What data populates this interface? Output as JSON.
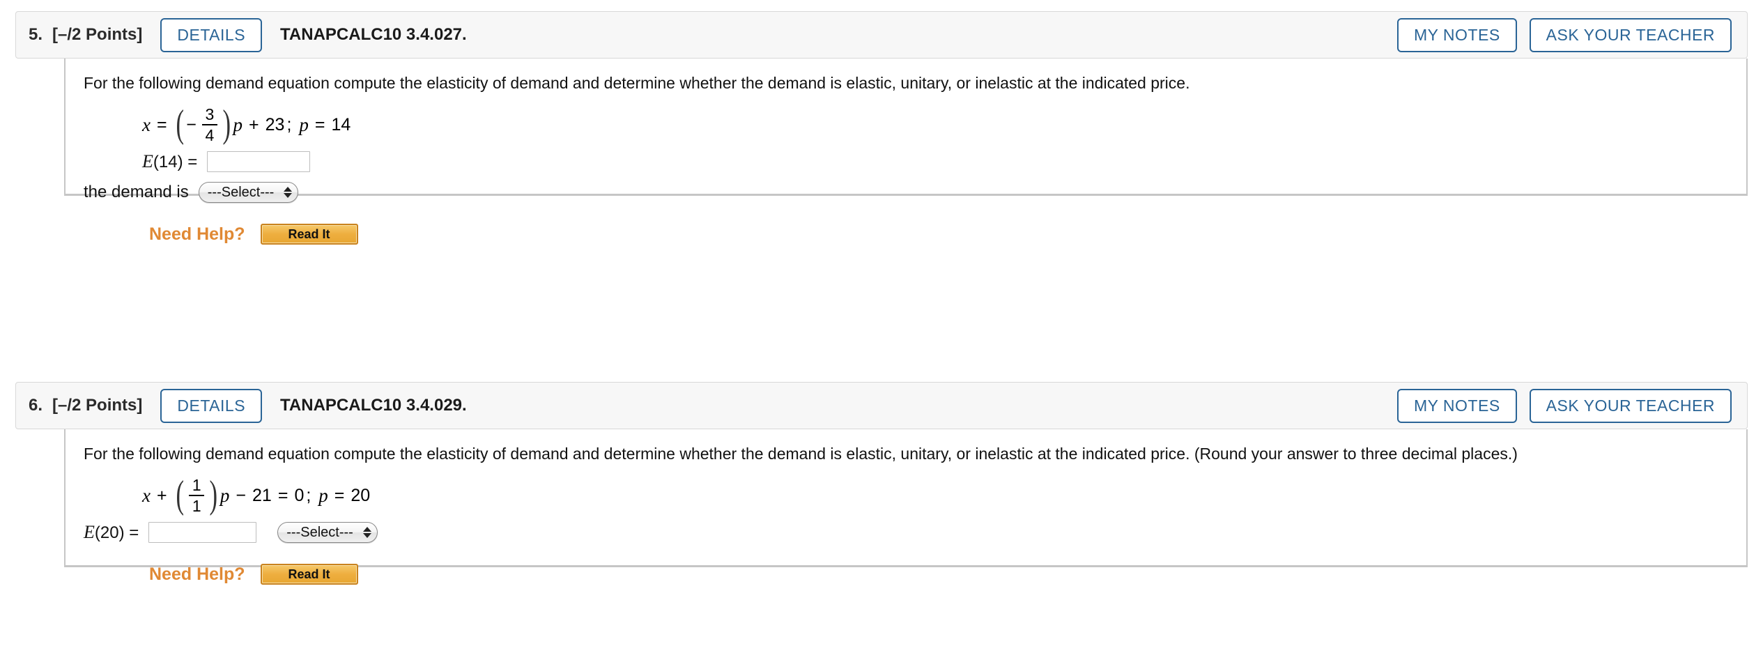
{
  "questions": [
    {
      "number": "5.",
      "points": "[–/2 Points]",
      "details_label": "DETAILS",
      "code": "TANAPCALC10 3.4.027.",
      "my_notes_label": "MY NOTES",
      "ask_teacher_label": "ASK YOUR TEACHER",
      "prompt": "For the following demand equation compute the elasticity of demand and determine whether the demand is elastic, unitary, or inelastic at the indicated price.",
      "equation": {
        "lhs_var": "x",
        "eq_sign": "=",
        "paren_open": "(",
        "negative_sign": "−",
        "frac_num": "3",
        "frac_den": "4",
        "paren_close": ")",
        "post_paren_var": "p",
        "plus_sign": "+",
        "constant": "23",
        "semicolon": ";",
        "price_var": "p",
        "price_eq": "=",
        "price_value": "14",
        "plain": "x = (−3/4)p + 23; p = 14"
      },
      "answer_label_prefix": "E",
      "answer_label_arg": "(14) =",
      "answer_value": "",
      "demand_label": "the demand is",
      "select_value": "---Select---",
      "need_help_label": "Need Help?",
      "read_it_label": "Read It",
      "layout": "stacked"
    },
    {
      "number": "6.",
      "points": "[–/2 Points]",
      "details_label": "DETAILS",
      "code": "TANAPCALC10 3.4.029.",
      "my_notes_label": "MY NOTES",
      "ask_teacher_label": "ASK YOUR TEACHER",
      "prompt": "For the following demand equation compute the elasticity of demand and determine whether the demand is elastic, unitary, or inelastic at the indicated price. (Round your answer to three decimal places.)",
      "equation": {
        "lhs_var": "x",
        "plus_sign_lead": "+",
        "paren_open": "(",
        "frac_num": "1",
        "frac_den": "1",
        "paren_close": ")",
        "post_paren_var": "p",
        "minus_sign": "−",
        "constant": "21",
        "eq_sign": "=",
        "rhs_value": "0",
        "semicolon": ";",
        "price_var": "p",
        "price_eq": "=",
        "price_value": "20",
        "plain": "x + (1/1)p − 21 = 0; p = 20"
      },
      "answer_label_prefix": "E",
      "answer_label_arg": "(20) =",
      "answer_value": "",
      "select_value": "---Select---",
      "need_help_label": "Need Help?",
      "read_it_label": "Read It",
      "layout": "inline"
    }
  ],
  "colors": {
    "accent_blue": "#2a6496",
    "need_help_orange": "#e08934",
    "read_it_gold": "#eeae3f",
    "header_bg": "#f7f7f7",
    "border_gray": "#c6c6c6"
  }
}
